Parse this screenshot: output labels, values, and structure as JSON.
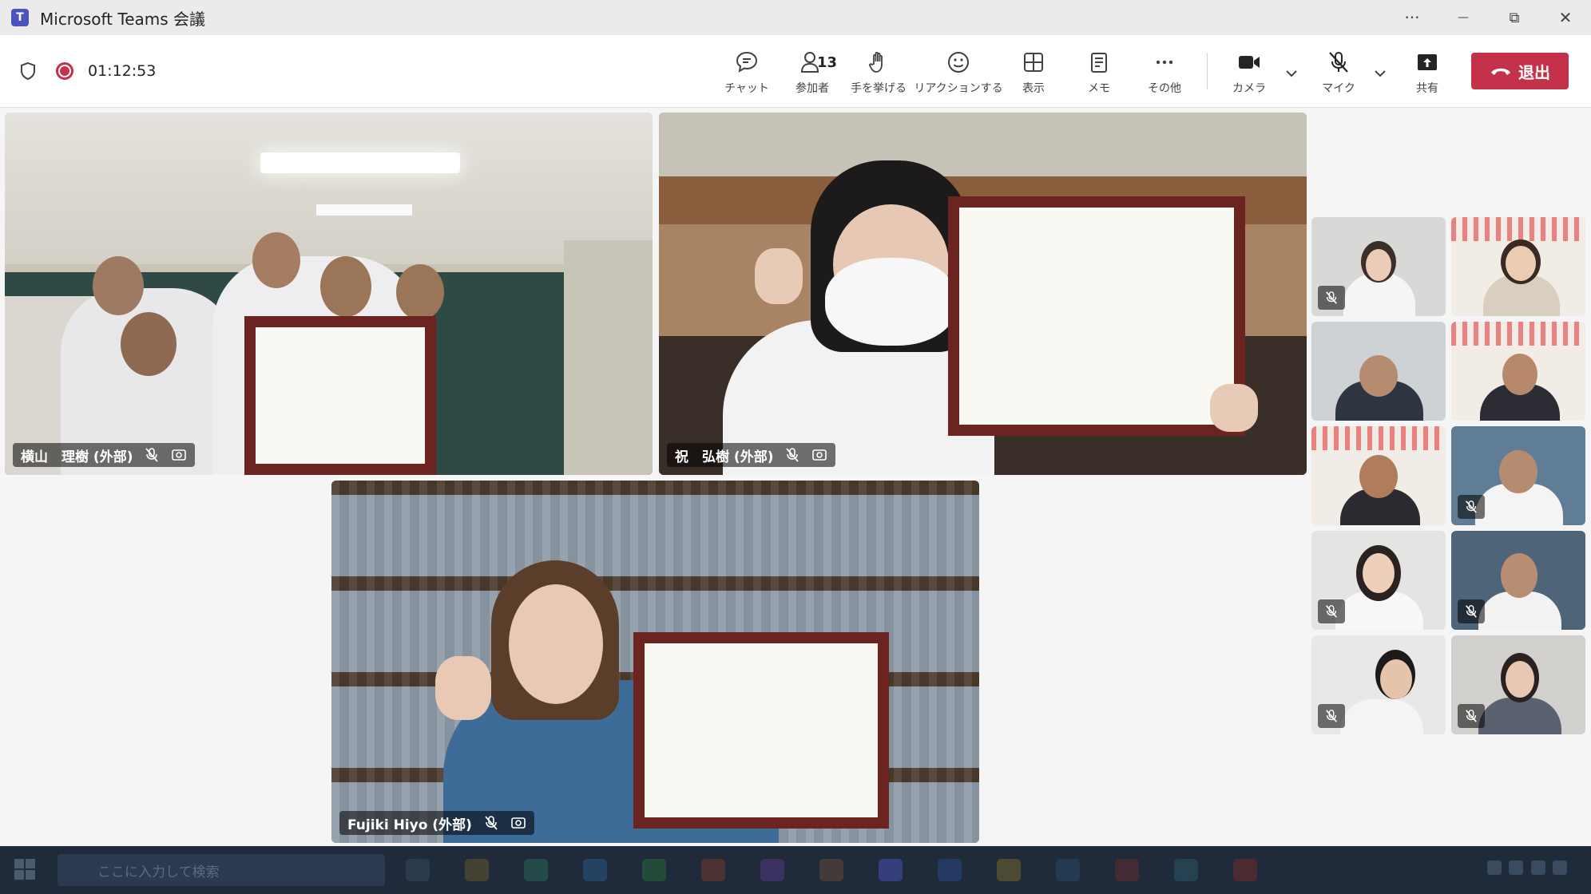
{
  "titlebar": {
    "app_title": "Microsoft Teams 会議",
    "more_label": "···",
    "minimize_label": "—",
    "restore_label": "⧉",
    "close_label": "✕"
  },
  "meeting": {
    "timer": "01:12:53",
    "participant_count": "13"
  },
  "toolbar": {
    "chat_label": "チャット",
    "people_label": "参加者",
    "raise_hand_label": "手を挙げる",
    "react_label": "リアクションする",
    "view_label": "表示",
    "notes_label": "メモ",
    "more_label": "その他",
    "camera_label": "カメラ",
    "mic_label": "マイク",
    "share_label": "共有",
    "leave_label": "退出"
  },
  "participants": [
    {
      "name": "横山　理樹 (外部)",
      "muted": true
    },
    {
      "name": "祝　弘樹 (外部)",
      "muted": true
    },
    {
      "name": "Fujiki Hiyo (外部)",
      "muted": true
    }
  ],
  "gallery": [
    {
      "muted": true
    },
    {
      "muted": false
    },
    {
      "muted": false
    },
    {
      "muted": false
    },
    {
      "muted": false
    },
    {
      "muted": true
    },
    {
      "muted": true
    },
    {
      "muted": true
    },
    {
      "muted": true
    },
    {
      "muted": true
    }
  ],
  "taskbar": {
    "search_placeholder": "ここに入力して検索"
  },
  "colors": {
    "accent": "#4b53bc",
    "leave": "#c4314b",
    "recording": "#c4314b",
    "taskbar": "#1f2a3a"
  }
}
